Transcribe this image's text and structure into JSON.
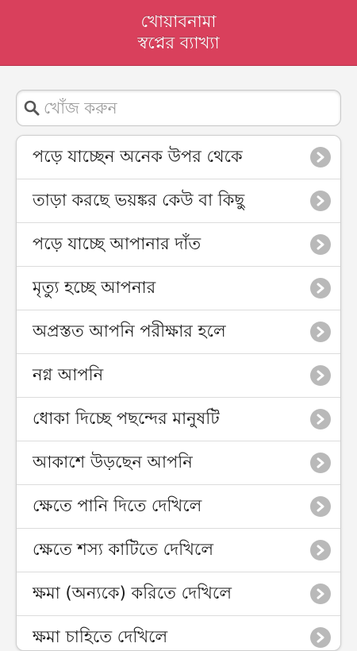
{
  "header": {
    "title_line1": "খোয়াবনামা",
    "title_line2": "স্বপ্নের ব্যাখ্যা",
    "bg_color": "#d9405c"
  },
  "search": {
    "placeholder": "খোঁজ করুন",
    "value": "",
    "icon": "search-icon"
  },
  "list": {
    "chevron_icon": "chevron-right-icon",
    "items": [
      {
        "label": "পড়ে যাচ্ছেন অনেক উপর থেকে"
      },
      {
        "label": "তাড়া করছে ভয়ঙ্কর কেউ বা কিছু"
      },
      {
        "label": "পড়ে যাচ্ছে আপানার দাঁত"
      },
      {
        "label": "মৃত্যু হচ্ছে আপনার"
      },
      {
        "label": "অপ্রস্তত আপনি পরীক্ষার হলে"
      },
      {
        "label": "নগ্ন আপনি"
      },
      {
        "label": "ধোকা দিচ্ছে পছন্দের মানুষটি"
      },
      {
        "label": "আকাশে উড়ছেন আপনি"
      },
      {
        "label": "ক্ষেতে পানি দিতে দেখিলে"
      },
      {
        "label": "ক্ষেতে শস্য কাটিতে দেখিলে"
      },
      {
        "label": "ক্ষমা (অন্যকে) করিতে দেখিলে"
      },
      {
        "label": "ক্ষমা চাহিতে দেখিলে"
      }
    ]
  }
}
